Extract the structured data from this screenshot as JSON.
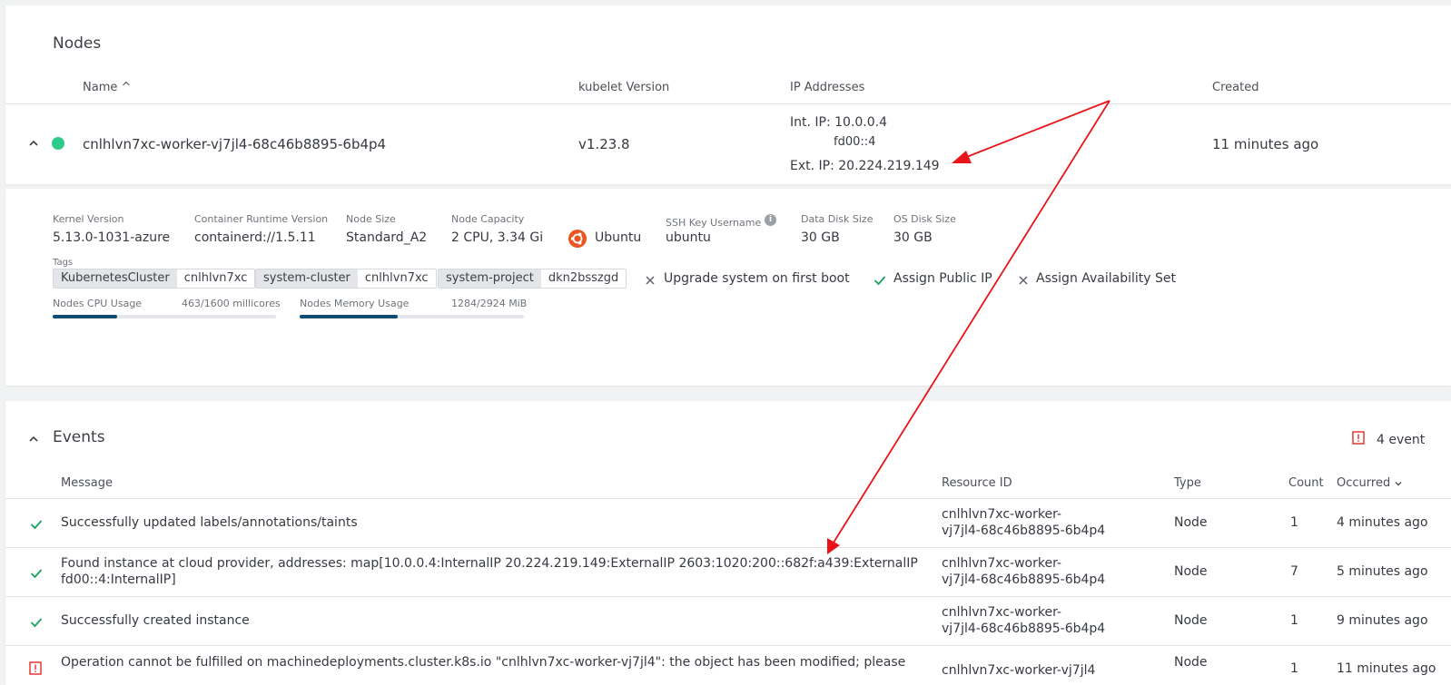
{
  "nodes": {
    "title": "Nodes",
    "columns": {
      "name": "Name ^",
      "kubelet": "kubelet Version",
      "ip": "IP Addresses",
      "created": "Created"
    },
    "row": {
      "name": "cnlhlvn7xc-worker-vj7jl4-68c46b8895-6b4p4",
      "kubelet": "v1.23.8",
      "int_ip_label": "Int. IP: 10.0.0.4",
      "int_ip_v6": "fd00::4",
      "ext_ip_label": "Ext. IP: 20.224.219.149",
      "created": "11 minutes ago",
      "status_color": "#2ecc8a"
    },
    "details": {
      "kernel": {
        "label": "Kernel Version",
        "value": "5.13.0-1031-azure"
      },
      "runtime": {
        "label": "Container Runtime Version",
        "value": "containerd://1.5.11"
      },
      "size": {
        "label": "Node Size",
        "value": "Standard_A2"
      },
      "capacity": {
        "label": "Node Capacity",
        "value": "2 CPU, 3.34 Gi"
      },
      "os": {
        "value": "Ubuntu"
      },
      "ssh": {
        "label": "SSH Key Username",
        "value": "ubuntu"
      },
      "data_disk": {
        "label": "Data Disk Size",
        "value": "30 GB"
      },
      "os_disk": {
        "label": "OS Disk Size",
        "value": "30 GB"
      },
      "tags_label": "Tags",
      "tags": [
        {
          "key": "KubernetesCluster",
          "value": "cnlhlvn7xc"
        },
        {
          "key": "system-cluster",
          "value": "cnlhlvn7xc"
        },
        {
          "key": "system-project",
          "value": "dkn2bsszgd"
        }
      ],
      "flags": {
        "upgrade": "Upgrade system on first boot",
        "public_ip": "Assign Public IP",
        "availability": "Assign Availability Set"
      },
      "cpu": {
        "label": "Nodes CPU Usage",
        "value": "463/1600 millicores",
        "fraction": 0.289
      },
      "memory": {
        "label": "Nodes Memory Usage",
        "value": "1284/2924 MiB",
        "fraction": 0.439
      }
    }
  },
  "events": {
    "title": "Events",
    "count_text": "4 event",
    "columns": {
      "message": "Message",
      "resource": "Resource ID",
      "type": "Type",
      "count": "Count",
      "occurred": "Occurred"
    },
    "rows": [
      {
        "message_1": "Successfully updated labels/annotations/taints",
        "message_2": "",
        "resource_1": "cnlhlvn7xc-worker-",
        "resource_2": "vj7jl4-68c46b8895-6b4p4",
        "type": "Node",
        "count": "1",
        "occurred": "4 minutes ago",
        "status": "ok"
      },
      {
        "message_1": "Found instance at cloud provider, addresses: map[10.0.0.4:InternalIP 20.224.219.149:ExternalIP 2603:1020:200::682f:a439:ExternalIP",
        "message_2": "fd00::4:InternalIP]",
        "resource_1": "cnlhlvn7xc-worker-",
        "resource_2": "vj7jl4-68c46b8895-6b4p4",
        "type": "Node",
        "count": "7",
        "occurred": "5 minutes ago",
        "status": "ok"
      },
      {
        "message_1": "Successfully created instance",
        "message_2": "",
        "resource_1": "cnlhlvn7xc-worker-",
        "resource_2": "vj7jl4-68c46b8895-6b4p4",
        "type": "Node",
        "count": "1",
        "occurred": "9 minutes ago",
        "status": "ok"
      },
      {
        "message_1": "Operation cannot be fulfilled on machinedeployments.cluster.k8s.io \"cnlhlvn7xc-worker-vj7jl4\": the object has been modified; please",
        "message_2": "",
        "resource_1": "cnlhlvn7xc-worker-vj7jl4",
        "resource_2": "",
        "type": "Node",
        "count": "1",
        "occurred": "11 minutes ago",
        "status": "warning"
      }
    ]
  },
  "colors": {
    "accent": "#0d4a74",
    "success": "#1aa35d",
    "warning": "#e02b2b",
    "annotation": "#e8141a"
  }
}
